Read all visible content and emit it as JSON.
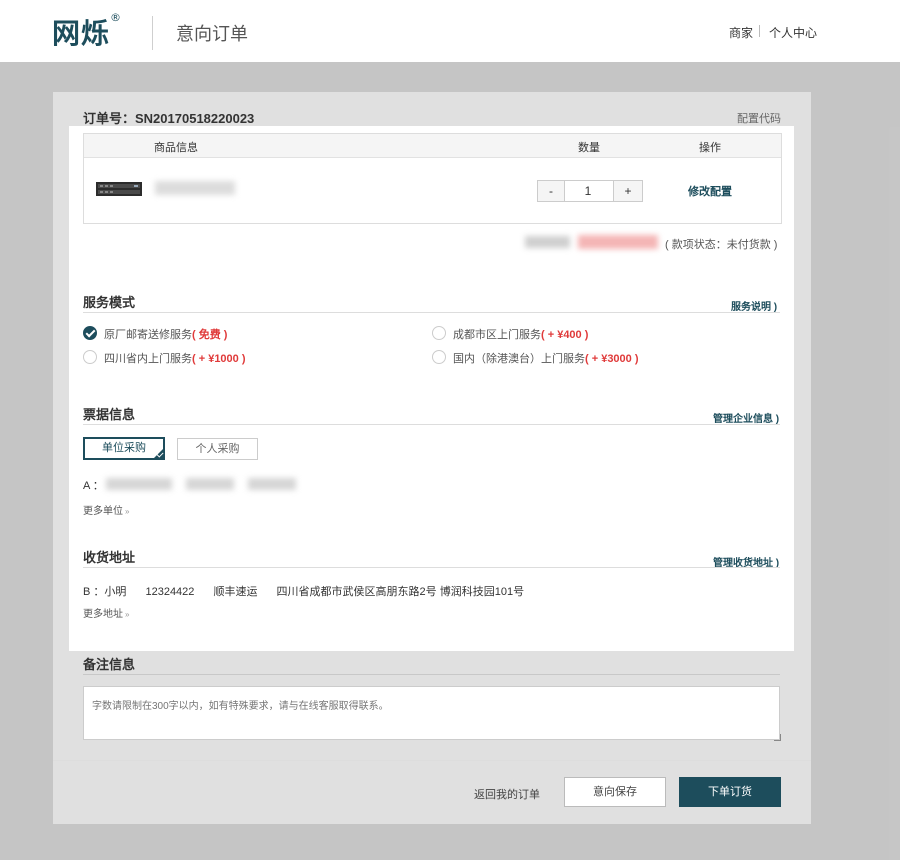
{
  "header": {
    "logo": "网烁",
    "logo_mark": "®",
    "page_title": "意向订单",
    "nav": {
      "merchant": "商家",
      "user_center": "个人中心"
    }
  },
  "order": {
    "number_label": "订单号：SN20170518220023",
    "config_code": "配置代码"
  },
  "product_table": {
    "headers": {
      "info": "商品信息",
      "quantity": "数量",
      "action": "操作"
    },
    "row": {
      "quantity": "1",
      "minus": "-",
      "plus": "+",
      "action_label": "修改配置"
    }
  },
  "payment_status": "( 款项状态：未付货款 )",
  "service": {
    "title": "服务模式",
    "link": "服务说明 )",
    "options": [
      {
        "label": "原厂邮寄送修服务",
        "price": "( 免费 )",
        "checked": true
      },
      {
        "label": "成都市区上门服务",
        "price": "( + ¥400 )",
        "checked": false
      },
      {
        "label": "四川省内上门服务",
        "price": "( + ¥1000 )",
        "checked": false
      },
      {
        "label": "国内（除港澳台）上门服务",
        "price": "( + ¥3000 )",
        "checked": false
      }
    ]
  },
  "invoice": {
    "title": "票据信息",
    "link": "管理企业信息 )",
    "tabs": {
      "unit": "单位采购",
      "personal": "个人采购"
    },
    "entry_prefix": "A ：",
    "more": "更多单位",
    "more_icon": "»"
  },
  "shipping": {
    "title": "收货地址",
    "link": "管理收货地址 )",
    "entry": {
      "prefix": "B ：小明",
      "phone": "12324422",
      "courier": "顺丰速运",
      "address": "四川省成都市武侯区高朋东路2号 博润科技园101号"
    },
    "more": "更多地址",
    "more_icon": "»"
  },
  "remarks": {
    "title": "备注信息",
    "placeholder": "字数请限制在300字以内，如有特殊要求，请与在线客服取得联系。"
  },
  "footer": {
    "back_link": "返回我的订单",
    "save_button": "意向保存",
    "submit_button": "下单订货"
  },
  "colors": {
    "brand": "#1d4d5c",
    "price": "#e03a3a"
  }
}
